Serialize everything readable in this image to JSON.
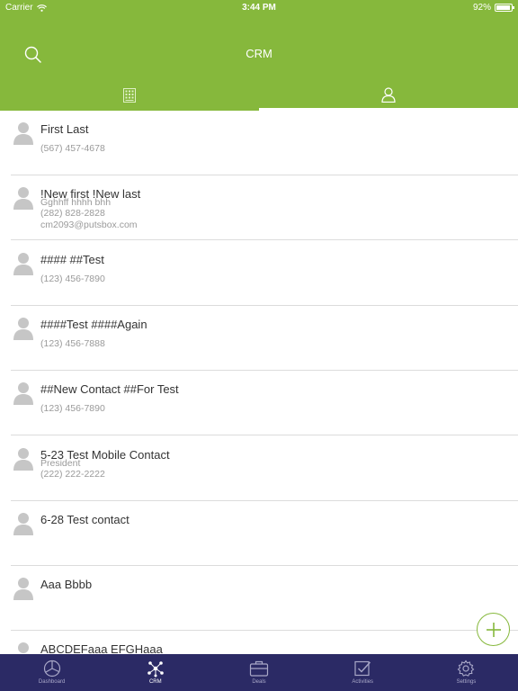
{
  "status_bar": {
    "carrier": "Carrier",
    "time": "3:44 PM",
    "battery": "92%",
    "battery_level": 0.92
  },
  "header": {
    "title": "CRM",
    "search_icon": "search-icon",
    "tabs": [
      {
        "icon": "grid-icon",
        "selected": true
      },
      {
        "icon": "person-icon",
        "selected": false
      }
    ]
  },
  "contacts": [
    {
      "name": "First  Last",
      "lines": [
        "",
        "(567) 457-4678"
      ]
    },
    {
      "name": "!New first !New last",
      "lines": [
        "Gghhff hhhh bhh",
        "(282) 828-2828",
        "cm2093@putsbox.com"
      ]
    },
    {
      "name": "#### ##Test",
      "lines": [
        "",
        "(123) 456-7890"
      ]
    },
    {
      "name": "####Test ####Again",
      "lines": [
        "",
        "(123) 456-7888"
      ]
    },
    {
      "name": "##New Contact ##For Test",
      "lines": [
        "",
        "(123) 456-7890"
      ]
    },
    {
      "name": "5-23 Test Mobile Contact",
      "lines": [
        "President",
        "(222) 222-2222"
      ]
    },
    {
      "name": "6-28 Test contact",
      "lines": []
    },
    {
      "name": "Aaa Bbbb",
      "lines": []
    },
    {
      "name": "ABCDEFaaa EFGHaaa",
      "lines": []
    }
  ],
  "fab": {
    "icon": "plus-icon"
  },
  "bottom_nav": [
    {
      "label": "Dashboard",
      "icon": "pie-chart-icon",
      "active": false
    },
    {
      "label": "CRM",
      "icon": "network-icon",
      "active": true
    },
    {
      "label": "Deals",
      "icon": "briefcase-icon",
      "active": false
    },
    {
      "label": "Activities",
      "icon": "checkbox-icon",
      "active": false
    },
    {
      "label": "Settings",
      "icon": "gear-icon",
      "active": false
    }
  ],
  "colors": {
    "header_green": "#86b83c",
    "nav_bg": "#2b2a65",
    "text_primary": "#333333",
    "text_secondary": "#9a9a9a"
  }
}
